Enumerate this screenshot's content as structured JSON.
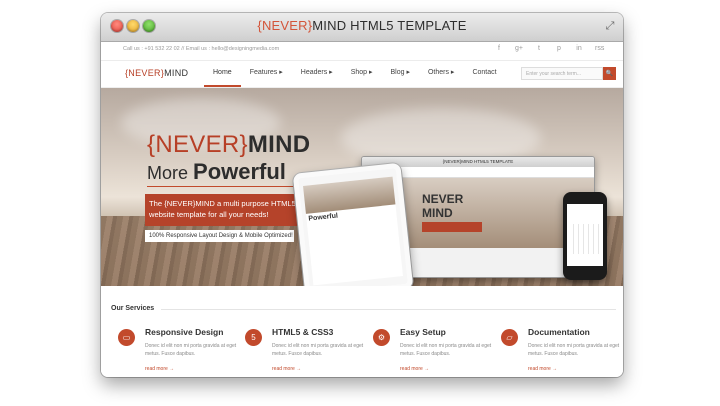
{
  "window": {
    "title_bracket": "{NEVER}",
    "title_rest": "MIND HTML5 TEMPLATE",
    "expand_icon": "⤢"
  },
  "topbar": {
    "contact": "Call us : +91 532 22 02 // Email us : hello@designingmedia.com",
    "social_icons": [
      "f",
      "g+",
      "t",
      "p",
      "in",
      "rss"
    ]
  },
  "nav": {
    "logo_bracket": "{NEVER}",
    "logo_rest": "MIND",
    "items": [
      "Home",
      "Features ▸",
      "Headers ▸",
      "Shop ▸",
      "Blog ▸",
      "Others ▸",
      "Contact"
    ],
    "search_placeholder": "Enter your search term...",
    "search_icon": "🔍"
  },
  "hero": {
    "brand_bracket": "{NEVER}",
    "brand_rest": "MIND",
    "sub_light": "More ",
    "sub_bold": "Powerful",
    "red_text": "The {NEVER}MIND a multi purpose HTML5 website template for all your needs!",
    "white_text": "100% Responsive Layout Design & Mobile Optimized!",
    "mock_title": "{NEVER}MIND HTML5 TEMPLATE",
    "mock_logo": "{NEVER}MIND",
    "mock_line1": "NEVER",
    "mock_line2": "MIND",
    "tablet_text": "Powerful"
  },
  "services": {
    "title": "Our Services",
    "items": [
      {
        "icon": "▭",
        "name": "Responsive Design",
        "desc": "Donec id elit non mi porta gravida at eget metus. Fusce dapibus.",
        "link": "read more →"
      },
      {
        "icon": "5",
        "name": "HTML5 & CSS3",
        "desc": "Donec id elit non mi porta gravida at eget metus. Fusce dapibus.",
        "link": "read more →"
      },
      {
        "icon": "⚙",
        "name": "Easy Setup",
        "desc": "Donec id elit non mi porta gravida at eget metus. Fusce dapibus.",
        "link": "read more →"
      },
      {
        "icon": "▱",
        "name": "Documentation",
        "desc": "Donec id elit non mi porta gravida at eget metus. Fusce dapibus.",
        "link": "read more →"
      }
    ]
  },
  "colors": {
    "accent": "#c24a2c",
    "dark": "#2d2d2d"
  }
}
